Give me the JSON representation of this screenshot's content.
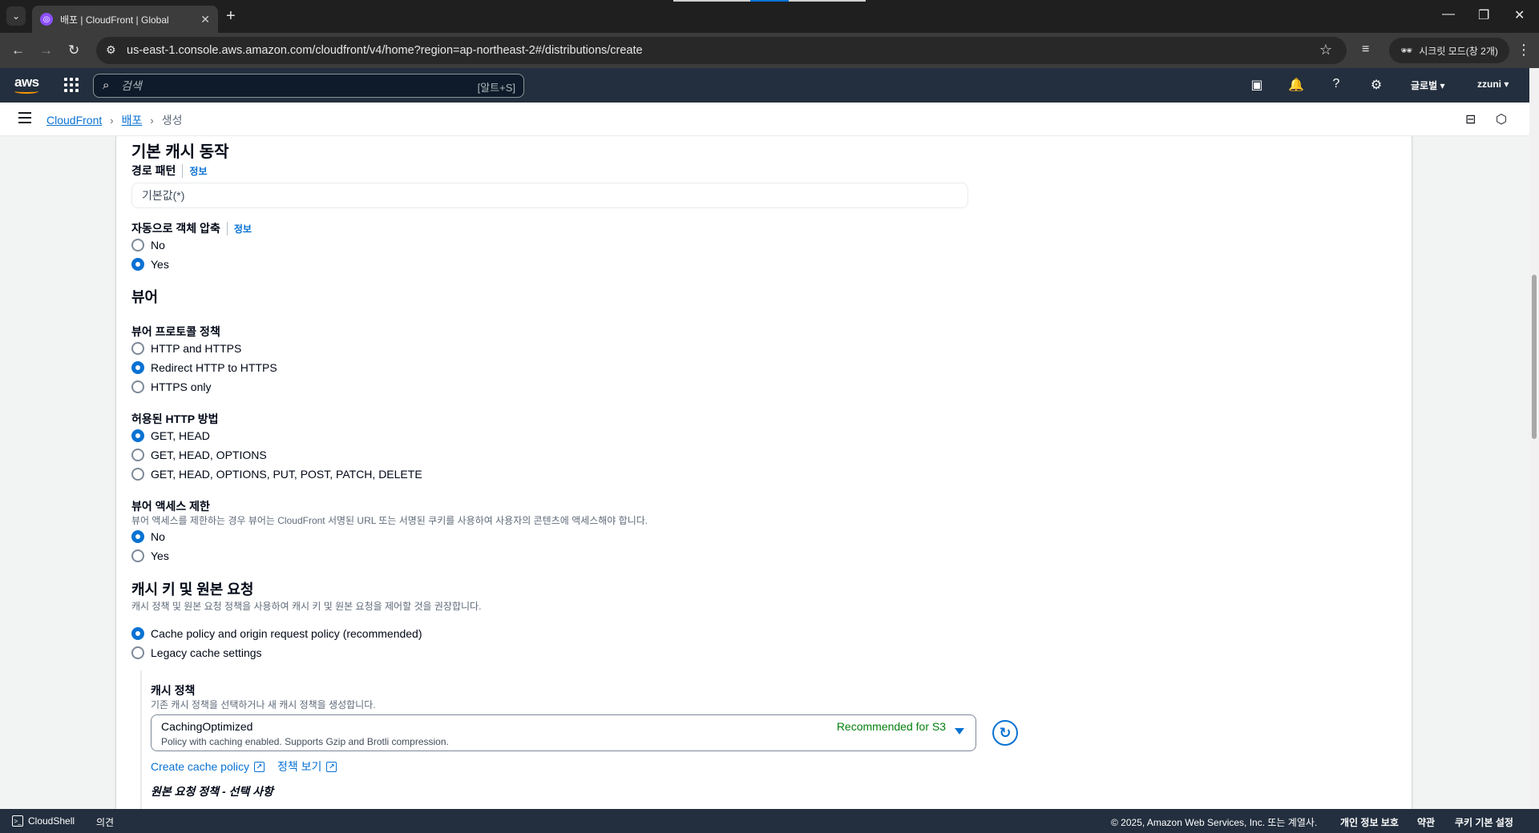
{
  "browser": {
    "tab_title": "배포 | CloudFront | Global",
    "tab_close": "✕",
    "new_tab": "+",
    "url": "us-east-1.console.aws.amazon.com/cloudfront/v4/home?region=ap-northeast-2#/distributions/create",
    "incognito_label": "시크릿 모드(창 2개)"
  },
  "aws_nav": {
    "logo_text": "aws",
    "search_placeholder": "검색",
    "search_shortcut": "[알트+S]",
    "region_menu": "글로벌 ▾",
    "user_menu": "zzuni ▾"
  },
  "breadcrumb": {
    "items": [
      "CloudFront",
      "배포",
      "생성"
    ],
    "separator": "›"
  },
  "form": {
    "default_cache_title": "기본 캐시 동작",
    "path_pattern": {
      "label": "경로 패턴",
      "info": "정보",
      "value": "기본값(*)"
    },
    "compress": {
      "label": "자동으로 객체 압축",
      "info": "정보",
      "options": [
        "No",
        "Yes"
      ],
      "selected": "Yes"
    },
    "viewer_title": "뷰어",
    "viewer_protocol": {
      "label": "뷰어 프로토콜 정책",
      "options": [
        "HTTP and HTTPS",
        "Redirect HTTP to HTTPS",
        "HTTPS only"
      ],
      "selected": "Redirect HTTP to HTTPS"
    },
    "http_methods": {
      "label": "허용된 HTTP 방법",
      "options": [
        "GET, HEAD",
        "GET, HEAD, OPTIONS",
        "GET, HEAD, OPTIONS, PUT, POST, PATCH, DELETE"
      ],
      "selected": "GET, HEAD"
    },
    "viewer_access": {
      "label": "뷰어 액세스 제한",
      "description": "뷰어 액세스를 제한하는 경우 뷰어는 CloudFront 서명된 URL 또는 서명된 쿠키를 사용하여 사용자의 콘텐츠에 액세스해야 합니다.",
      "options": [
        "No",
        "Yes"
      ],
      "selected": "No"
    },
    "cache_key": {
      "title": "캐시 키 및 원본 요청",
      "description": "캐시 정책 및 원본 요청 정책을 사용하여 캐시 키 및 원본 요청을 제어할 것을 권장합니다.",
      "options": [
        "Cache policy and origin request policy (recommended)",
        "Legacy cache settings"
      ],
      "selected": "Cache policy and origin request policy (recommended)"
    },
    "cache_policy": {
      "label": "캐시 정책",
      "description": "기존 캐시 정책을 선택하거나 새 캐시 정책을 생성합니다.",
      "selected_name": "CachingOptimized",
      "selected_desc": "Policy with caching enabled. Supports Gzip and Brotli compression.",
      "tag": "Recommended for S3",
      "create_link": "Create cache policy",
      "view_link": "정책 보기"
    },
    "origin_request_policy_label": "원본 요청 정책 - 선택 사항"
  },
  "footer": {
    "cloudshell": "CloudShell",
    "feedback": "의견",
    "copyright": "© 2025, Amazon Web Services, Inc. 또는 계열사.",
    "privacy": "개인 정보 보호",
    "terms": "약관",
    "cookies": "쿠키 기본 설정"
  },
  "colors": {
    "link": "#0972d3",
    "aws_nav_bg": "#232f3e",
    "success_tag": "#037f0c"
  }
}
